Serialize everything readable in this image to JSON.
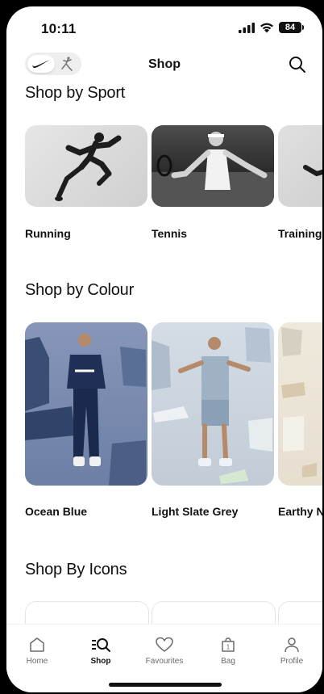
{
  "status": {
    "time": "10:11",
    "battery": "84"
  },
  "header": {
    "title": "Shop"
  },
  "sections": {
    "sport": {
      "title": "Shop by Sport",
      "items": [
        {
          "label": "Running"
        },
        {
          "label": "Tennis"
        },
        {
          "label": "Training"
        }
      ]
    },
    "colour": {
      "title": "Shop by Colour",
      "items": [
        {
          "label": "Ocean Blue"
        },
        {
          "label": "Light Slate Grey"
        },
        {
          "label": "Earthy N"
        }
      ]
    },
    "icons": {
      "title": "Shop By Icons"
    }
  },
  "tabbar": {
    "items": [
      {
        "label": "Home",
        "icon": "home-icon"
      },
      {
        "label": "Shop",
        "icon": "shop-search-icon",
        "active": true
      },
      {
        "label": "Favourites",
        "icon": "heart-icon"
      },
      {
        "label": "Bag",
        "icon": "bag-icon",
        "badge": "1"
      },
      {
        "label": "Profile",
        "icon": "profile-icon"
      }
    ]
  },
  "colors": {
    "accent": "#111111",
    "ocean_blue": "#7a8fb3",
    "slate_grey": "#c9d3dc",
    "earthy": "#ece6da"
  }
}
